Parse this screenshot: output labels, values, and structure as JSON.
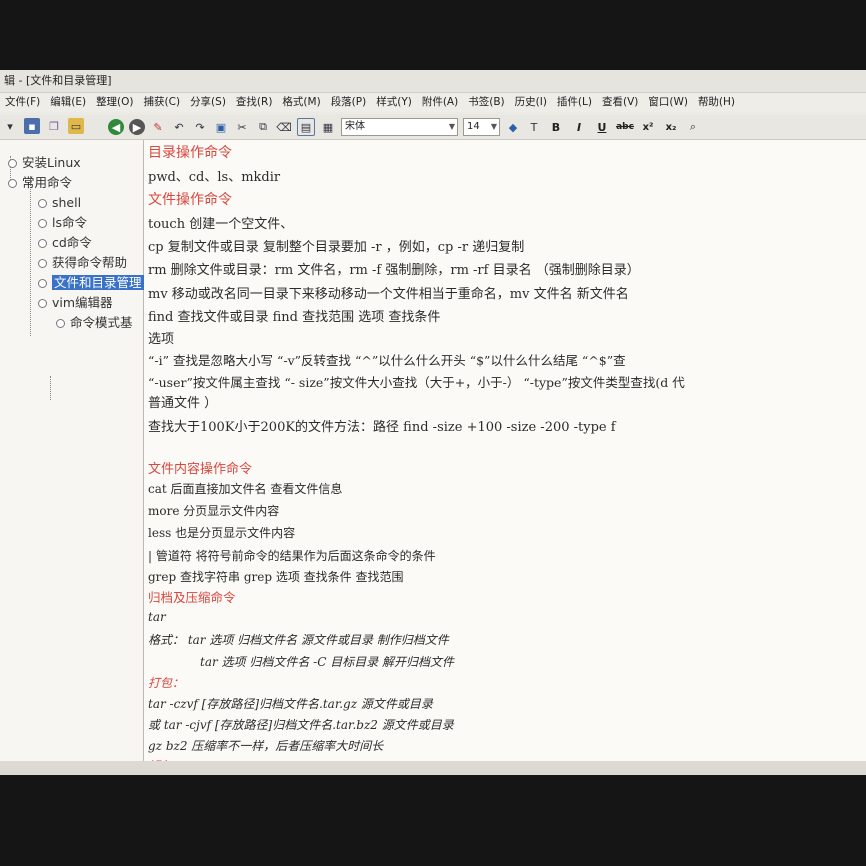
{
  "window": {
    "title": "辑 - [文件和目录管理]"
  },
  "menu": [
    "文件(F)",
    "编辑(E)",
    "整理(O)",
    "捕获(C)",
    "分享(S)",
    "查找(R)",
    "格式(M)",
    "段落(P)",
    "样式(Y)",
    "附件(A)",
    "书签(B)",
    "历史(I)",
    "插件(L)",
    "查看(V)",
    "窗口(W)",
    "帮助(H)"
  ],
  "toolbar": {
    "font_name": "宋体",
    "font_size": "14",
    "format_buttons": [
      "B",
      "I",
      "U",
      "abc",
      "x²",
      "x₂"
    ]
  },
  "tree": [
    {
      "label": "安装Linux"
    },
    {
      "label": "常用命令"
    },
    {
      "label": "shell"
    },
    {
      "label": "ls命令"
    },
    {
      "label": "cd命令"
    },
    {
      "label": "获得命令帮助"
    },
    {
      "label": "文件和目录管理"
    },
    {
      "label": "vim编辑器"
    },
    {
      "label": "命令模式基"
    }
  ],
  "content": [
    "目录操作命令",
    "pwd、cd、ls、mkdir",
    "文件操作命令",
    "touch  创建一个空文件、",
    "cp  复制文件或目录  复制整个目录要加 -r ，例如，cp -r   递归复制",
    "rm  删除文件或目录：rm 文件名，rm -f 强制删除，rm -rf 目录名 （强制删除目录）",
    "mv  移动或改名同一目录下来移动移动一个文件相当于重命名，mv 文件名  新文件名",
    "find  查找文件或目录      find   查找范围  选项 查找条件",
    "选项",
    "“-i”  查找是忽略大小写      “-v”反转查找     “^”以什么什么开头      “$”以什么什么结尾    “^$”查",
    "“-user”按文件属主查找          “- size”按文件大小查找（大于+，小于-）          “-type”按文件类型查找(d 代",
    "普通文件  ）",
    "查找大于100K小于200K的文件方法：路径 find -size +100 -size -200 -type f",
    "文件内容操作命令",
    "cat     后面直接加文件名 查看文件信息",
    "more    分页显示文件内容",
    "less    也是分页显示文件内容",
    "|     管道符           将符号前命令的结果作为后面这条命令的条件",
    "grep  查找字符串   grep 选项 查找条件 查找范围",
    "归档及压缩命令",
    "tar",
    "格式：  tar 选项 归档文件名 源文件或目录     制作归档文件",
    "tar 选项  归档文件名  -C 目标目录       解开归档文件",
    "打包：",
    "tar -czvf [存放路径]归档文件名.tar.gz 源文件或目录",
    "或 tar -cjvf [存放路径]归档文件名.tar.bz2 源文件或目录",
    "gz  bz2  压缩率不一样，后者压缩率大时间长",
    "解包："
  ],
  "colors": {
    "heading": "#d9473e",
    "selection": "#3a72c8"
  }
}
